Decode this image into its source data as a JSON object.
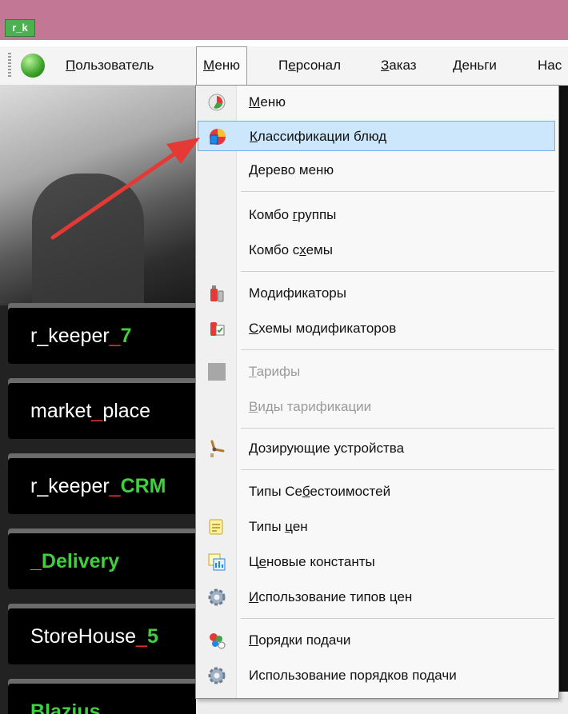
{
  "window": {
    "app_icon_text": "r_k"
  },
  "menubar": {
    "items": [
      {
        "pre": "",
        "u": "П",
        "post": "ользователь"
      },
      {
        "pre": "",
        "u": "М",
        "post": "еню"
      },
      {
        "pre": "П",
        "u": "е",
        "post": "рсонал"
      },
      {
        "pre": "",
        "u": "З",
        "post": "аказ"
      },
      {
        "pre": "",
        "u": "Д",
        "post": "еньги"
      },
      {
        "pre": "Нас",
        "u": "",
        "post": ""
      }
    ]
  },
  "tiles": [
    {
      "a": "r_keeper",
      "b": "_",
      "c": "7"
    },
    {
      "a": "market",
      "b": "_",
      "c": "place"
    },
    {
      "a": "r_keeper",
      "b": "_",
      "c": "CRM"
    },
    {
      "a": "",
      "b": "",
      "c": "_Delivery"
    },
    {
      "a": "StoreHouse",
      "b": "_",
      "c": "5"
    },
    {
      "a": "",
      "b": "",
      "c": "Blazius"
    }
  ],
  "dropdown": {
    "items": [
      {
        "pre": "",
        "u": "М",
        "post": "еню"
      },
      {
        "pre": "",
        "u": "К",
        "post": "лассификации блюд"
      },
      {
        "pre": "",
        "u": "Д",
        "post": "ерево меню"
      },
      {
        "pre": "Комбо ",
        "u": "г",
        "post": "руппы"
      },
      {
        "pre": "Комбо с",
        "u": "х",
        "post": "емы"
      },
      {
        "pre": "Мо",
        "u": "д",
        "post": "ификаторы"
      },
      {
        "pre": "",
        "u": "С",
        "post": "хемы модификаторов"
      },
      {
        "pre": "",
        "u": "Т",
        "post": "арифы"
      },
      {
        "pre": "",
        "u": "В",
        "post": "иды тарификации"
      },
      {
        "pre": "",
        "u": "Д",
        "post": "озирующие устройства"
      },
      {
        "pre": "Типы Се",
        "u": "б",
        "post": "естоимостей"
      },
      {
        "pre": "Типы ",
        "u": "ц",
        "post": "ен"
      },
      {
        "pre": "Ц",
        "u": "е",
        "post": "новые константы"
      },
      {
        "pre": "",
        "u": "И",
        "post": "спользование типов цен"
      },
      {
        "pre": "",
        "u": "П",
        "post": "орядки подачи"
      },
      {
        "pre": "Использование порядков подачи",
        "u": "",
        "post": ""
      }
    ]
  },
  "colors": {
    "titlebar": "#c27894",
    "highlight": "#cce6fb",
    "accent_green": "#3fcf3f",
    "arrow_red": "#e53935"
  }
}
